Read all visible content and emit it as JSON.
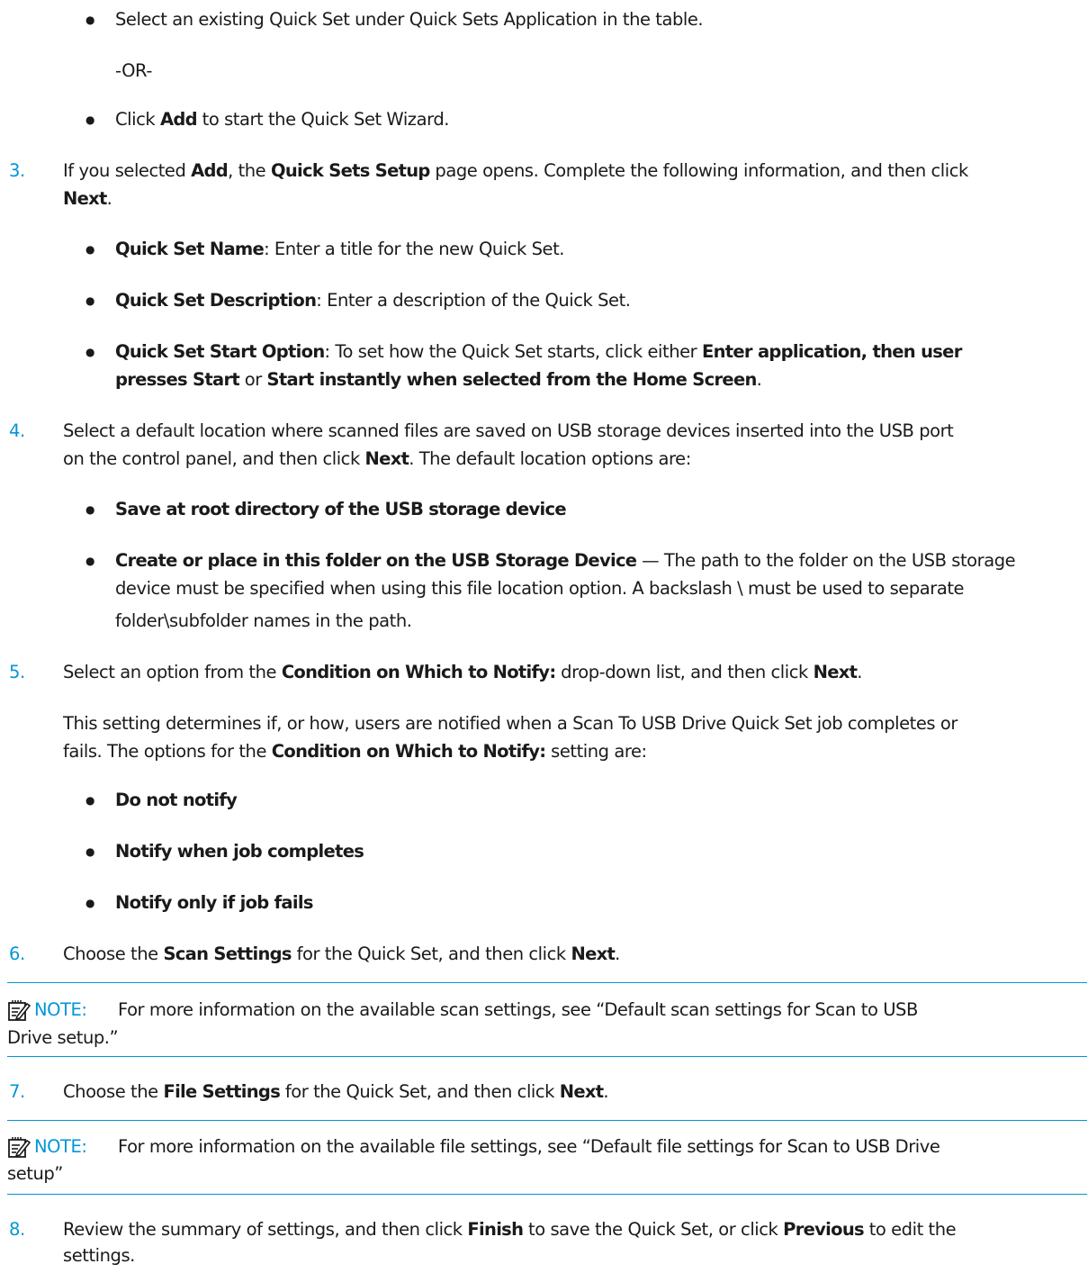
{
  "step2": {
    "bullet1": "Select an existing Quick Set under Quick Sets Application in the table.",
    "or": "-OR-",
    "bullet2": {
      "pre": "Click ",
      "b": "Add",
      "post": " to start the Quick Set Wizard."
    }
  },
  "step3": {
    "num": "3.",
    "line1": {
      "t1": "If you selected ",
      "b1": "Add",
      "t2": ", the ",
      "b2": "Quick Sets Setup",
      "t3": " page opens. Complete the following information, and then click"
    },
    "line2": {
      "b": "Next",
      "t": "."
    },
    "items": [
      {
        "b": "Quick Set Name",
        "t": ": Enter a title for the new Quick Set."
      },
      {
        "b": "Quick Set Description",
        "t": ": Enter a description of the Quick Set."
      }
    ],
    "start": {
      "b1": "Quick Set Start Option",
      "t1": ": To set how the Quick Set starts, click either ",
      "b2": "Enter application, then user",
      "b3": "presses Start",
      "t2": " or ",
      "b4": "Start instantly when selected from the Home Screen",
      "t3": "."
    }
  },
  "step4": {
    "num": "4.",
    "line1": "Select a default location where scanned files are saved on USB storage devices inserted into the USB port",
    "line2": {
      "t1": "on the control panel, and then click ",
      "b": "Next",
      "t2": ". The default location options are:"
    },
    "opt1": "Save at root directory of the USB storage device",
    "opt2": {
      "b": "Create or place in this folder on the USB Storage Device",
      "t1": " — The path to the folder on the USB storage",
      "t2": "device must be specified when using this file location option. A backslash \\ must be used to separate",
      "t3": "folder\\subfolder names in the path."
    }
  },
  "step5": {
    "num": "5.",
    "line1": {
      "t1": "Select an option from the ",
      "b1": "Condition on Which to Notify:",
      "t2": " drop-down list, and then click ",
      "b2": "Next",
      "t3": "."
    },
    "para1": "This setting determines if, or how, users are notified when a Scan To USB Drive Quick Set job completes or",
    "para2": {
      "t1": "fails. The options for the ",
      "b": "Condition on Which to Notify:",
      "t2": " setting are:"
    },
    "options": [
      "Do not notify",
      "Notify when job completes",
      "Notify only if job fails"
    ]
  },
  "step6": {
    "num": "6.",
    "line": {
      "t1": "Choose the ",
      "b1": "Scan Settings",
      "t2": " for the Quick Set, and then click ",
      "b2": "Next",
      "t3": "."
    },
    "note": {
      "label": "NOTE:",
      "l1": "For more information on the available scan settings, see “Default scan settings for Scan to USB",
      "l2": "Drive setup.”"
    }
  },
  "step7": {
    "num": "7.",
    "line": {
      "t1": "Choose the ",
      "b1": "File Settings",
      "t2": " for the Quick Set, and then click ",
      "b2": "Next",
      "t3": "."
    },
    "note": {
      "label": "NOTE:",
      "l1": "For more information on the available file settings, see “Default file settings for Scan to USB Drive",
      "l2": "setup”"
    }
  },
  "step8": {
    "num": "8.",
    "line1": {
      "t1": "Review the summary of settings, and then click ",
      "b1": "Finish",
      "t2": " to save the Quick Set, or click ",
      "b2": "Previous",
      "t3": " to edit the"
    },
    "line2": "settings."
  },
  "colors": {
    "accent": "#0096d6",
    "text": "#1a1a1a"
  },
  "icons": {
    "bullet": "●",
    "note": "note-icon"
  }
}
